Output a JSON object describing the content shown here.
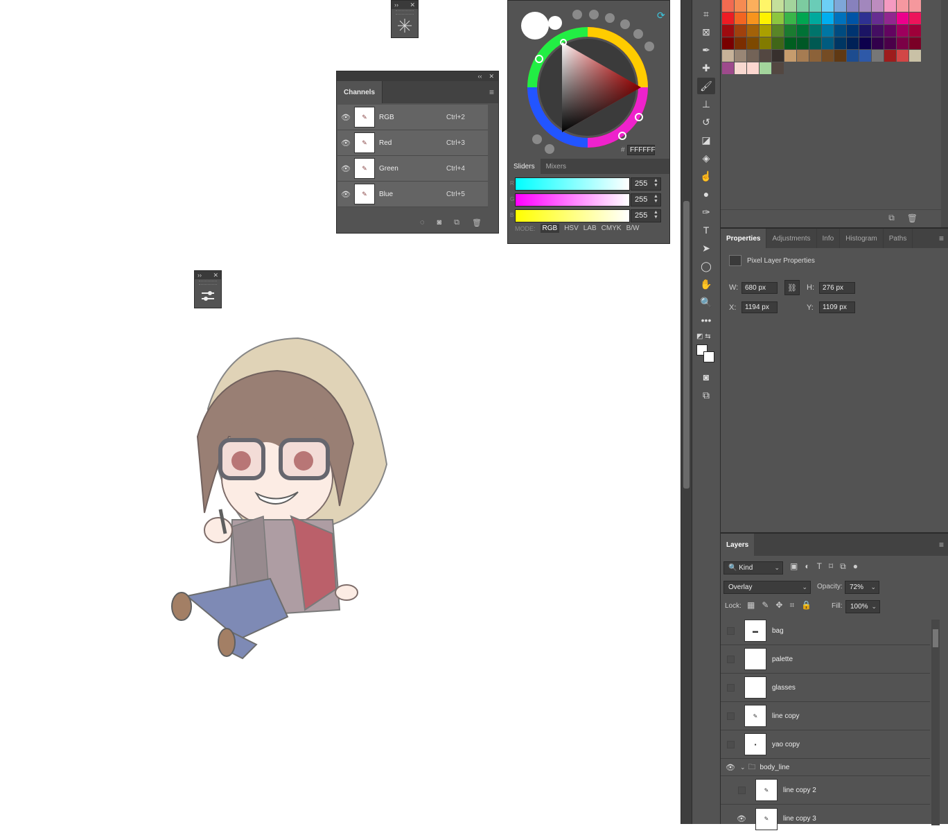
{
  "floating_panel_top": {
    "grip_icon": "brush-settings-icon",
    "bar_left": "››",
    "bar_right": "✕"
  },
  "floating_panel_mid": {
    "icon": "adjustments-slider-icon",
    "bar_left": "››",
    "bar_right": "✕"
  },
  "channels": {
    "bar_left": "‹‹",
    "bar_right": "✕",
    "tab": "Channels",
    "menu_icon": "≡",
    "rows": [
      {
        "name": "RGB",
        "shortcut": "Ctrl+2"
      },
      {
        "name": "Red",
        "shortcut": "Ctrl+3"
      },
      {
        "name": "Green",
        "shortcut": "Ctrl+4"
      },
      {
        "name": "Blue",
        "shortcut": "Ctrl+5"
      }
    ],
    "footer_icons": [
      "load-selection-icon",
      "save-selection-icon",
      "new-channel-icon",
      "delete-icon"
    ]
  },
  "color": {
    "hex": "FFFFFF",
    "hash": "#",
    "tabs": [
      "Sliders",
      "Mixers"
    ],
    "sliders": [
      {
        "label": "R",
        "value": "255",
        "gradient": "linear-gradient(90deg,#00ffff,#ffffff)"
      },
      {
        "label": "G",
        "value": "255",
        "gradient": "linear-gradient(90deg,#ff00ff,#ffffff)"
      },
      {
        "label": "B",
        "value": "255",
        "gradient": "linear-gradient(90deg,#ffff00,#ffffff)"
      }
    ],
    "mode_label": "MODE:",
    "modes": [
      "RGB",
      "HSV",
      "LAB",
      "CMYK",
      "B/W"
    ]
  },
  "tools": [
    "crop-icon",
    "frame-icon",
    "eyedropper-icon",
    "healing-brush-icon",
    "brush-icon",
    "stamp-icon",
    "history-brush-icon",
    "eraser-icon",
    "paint-bucket-icon",
    "smudge-icon",
    "dodge-icon",
    "pen-icon",
    "type-icon",
    "path-selection-icon",
    "ellipse-icon",
    "hand-icon",
    "zoom-icon",
    "more-icon"
  ],
  "swatches": {
    "colors": [
      "#f26b51",
      "#f68b52",
      "#fbaf5c",
      "#fff568",
      "#c4df9b",
      "#a3d49c",
      "#7ccba0",
      "#6accb7",
      "#6ccff6",
      "#7ea7d8",
      "#8781bd",
      "#a287bd",
      "#bd8cbf",
      "#f59ac1",
      "#f598a0",
      "#f5989d",
      "#ed1c24",
      "#f26522",
      "#f7941d",
      "#fff200",
      "#8dc63f",
      "#39b54a",
      "#00a651",
      "#00a99d",
      "#00aeef",
      "#0072bc",
      "#0054a6",
      "#2e3192",
      "#662d91",
      "#92278f",
      "#ec008c",
      "#ed145b",
      "#9e0b0f",
      "#a0410d",
      "#a36209",
      "#aba000",
      "#598527",
      "#1a7b30",
      "#007236",
      "#00746b",
      "#0076a3",
      "#004b80",
      "#003471",
      "#1b1464",
      "#440e62",
      "#630460",
      "#9e005d",
      "#9e0039",
      "#790000",
      "#7b2e00",
      "#7d4900",
      "#827b00",
      "#406618",
      "#005e20",
      "#005826",
      "#005952",
      "#005b7f",
      "#003663",
      "#002157",
      "#0d004c",
      "#32004b",
      "#4b0049",
      "#7b0046",
      "#7a0026",
      "#c7b299",
      "#998675",
      "#736357",
      "#534741",
      "#37302d",
      "#c69c6d",
      "#a67c52",
      "#8c6239",
      "#754c24",
      "#603913",
      "#1d4c8f",
      "#2e59a8",
      "#777777",
      "#9e1c1c",
      "#d24646",
      "#c9c1a6",
      "#9e4a8c",
      "#f8d8d0",
      "#fcd7d0",
      "#a3d49c",
      "#534741"
    ],
    "footer_icons": [
      "new-swatch-icon",
      "delete-icon"
    ]
  },
  "properties": {
    "tabs": [
      "Properties",
      "Adjustments",
      "Info",
      "Histogram",
      "Paths"
    ],
    "title": "Pixel Layer Properties",
    "w_label": "W:",
    "w": "680 px",
    "h_label": "H:",
    "h": "276 px",
    "x_label": "X:",
    "x": "1194 px",
    "y_label": "Y:",
    "y": "1109 px"
  },
  "layers": {
    "tab": "Layers",
    "filter_kind": "Kind",
    "blend_mode": "Overlay",
    "opacity_label": "Opacity:",
    "opacity": "72%",
    "lock_label": "Lock:",
    "fill_label": "Fill:",
    "fill": "100%",
    "rows": [
      {
        "name": "bag",
        "visible": false
      },
      {
        "name": "palette",
        "visible": false
      },
      {
        "name": "glasses",
        "visible": false
      },
      {
        "name": "line copy",
        "visible": false
      },
      {
        "name": "yao copy",
        "visible": false
      },
      {
        "name": "body_line",
        "visible": true,
        "group": true
      },
      {
        "name": "line copy 2",
        "visible": false,
        "indent": true
      },
      {
        "name": "line copy 3",
        "visible": true,
        "indent": true
      }
    ]
  }
}
